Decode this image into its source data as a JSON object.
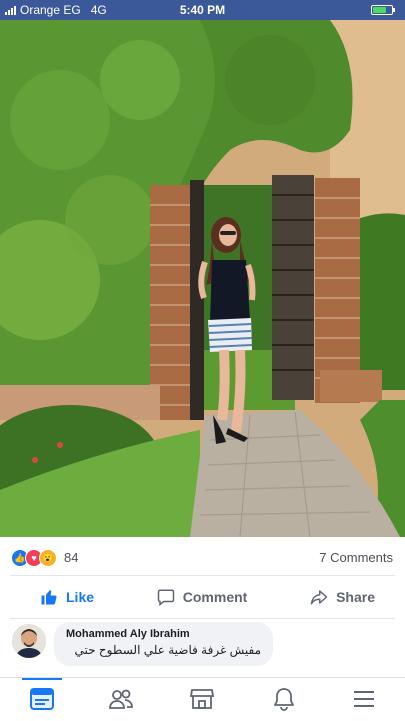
{
  "status_bar": {
    "carrier": "Orange EG",
    "network": "4G",
    "time": "5:40 PM",
    "battery_level": 0.7
  },
  "post": {
    "reactions": {
      "icons": [
        "like-reaction-icon",
        "love-reaction-icon",
        "wow-reaction-icon"
      ],
      "count": "84"
    },
    "comments_count": "7 Comments",
    "actions": {
      "like_label": "Like",
      "comment_label": "Comment",
      "share_label": "Share"
    }
  },
  "comment": {
    "author": "Mohammed Aly Ibrahim",
    "text": "مفيش غرفة فاضية علي السطوح حتي"
  },
  "tabbar": {
    "items": [
      "news-feed-icon",
      "friends-icon",
      "marketplace-icon",
      "notifications-bell-icon",
      "menu-icon"
    ],
    "active": "news-feed-icon"
  },
  "colors": {
    "brand": "#3b5898",
    "accent": "#1877f2",
    "battery": "#4cd964"
  }
}
